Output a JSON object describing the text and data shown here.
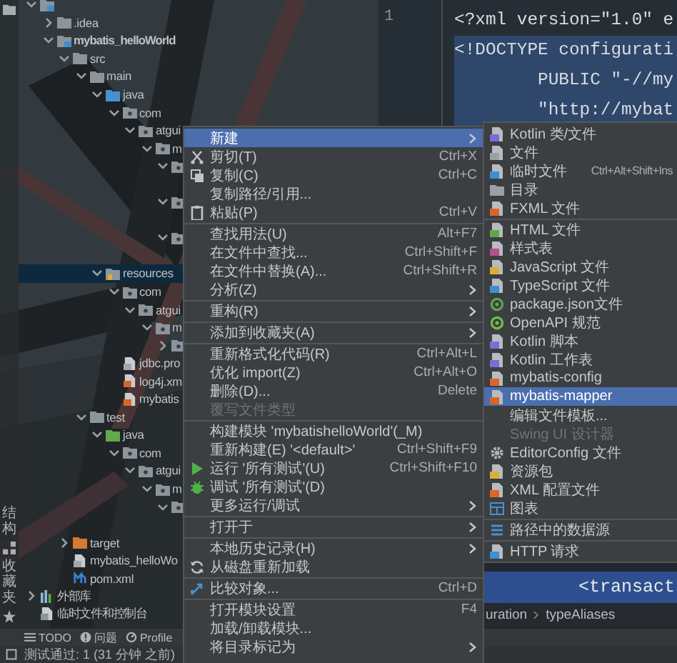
{
  "side_tabs": [
    {
      "label": "结构"
    },
    {
      "label": "收藏夹"
    }
  ],
  "project_tree": [
    {
      "kind": "module",
      "expanded": true,
      "selected": false,
      "children": [
        {
          "label": ".idea",
          "kind": "folder",
          "expanded": false,
          "selected": false
        },
        {
          "label": "mybatis_helloWorld",
          "kind": "module",
          "expanded": true,
          "selected": false,
          "children": [
            {
              "label": "src",
              "kind": "folder",
              "expanded": true,
              "selected": false,
              "children": [
                {
                  "label": "main",
                  "kind": "folder",
                  "expanded": true,
                  "selected": false,
                  "children": [
                    {
                      "label": "java",
                      "kind": "source-folder",
                      "expanded": true,
                      "selected": false,
                      "children": [
                        {
                          "label": "com",
                          "kind": "package",
                          "expanded": true,
                          "selected": false,
                          "children": [
                            {
                              "label": "atgui",
                              "kind": "package",
                              "expanded": true,
                              "selected": false,
                              "children": [
                                {
                                  "label": "m",
                                  "kind": "package",
                                  "expanded": true,
                                  "selected": false,
                                  "children": [
                                    {
                                      "kind": "package",
                                      "expanded": true,
                                      "selected": false
                                    },
                                    {
                                      "kind": "package",
                                      "expanded": true,
                                      "selected": false
                                    },
                                    {
                                      "kind": "package",
                                      "expanded": true,
                                      "selected": false
                                    }
                                  ]
                                }
                              ]
                            }
                          ]
                        }
                      ]
                    },
                    {
                      "label": "resources",
                      "kind": "resource-folder",
                      "expanded": true,
                      "selected": true,
                      "children": [
                        {
                          "label": "com",
                          "kind": "package",
                          "expanded": true,
                          "selected": false,
                          "children": [
                            {
                              "label": "atgui",
                              "kind": "package",
                              "expanded": true,
                              "selected": false,
                              "children": [
                                {
                                  "label": "m",
                                  "kind": "package",
                                  "expanded": true,
                                  "selected": false,
                                  "children": [
                                    {
                                      "kind": "package",
                                      "expanded": false,
                                      "selected": false
                                    }
                                  ]
                                }
                              ]
                            }
                          ]
                        },
                        {
                          "label": "jdbc.pro",
                          "kind": "properties-file",
                          "selected": false
                        },
                        {
                          "label": "log4j.xm",
                          "kind": "xml-file",
                          "selected": false
                        },
                        {
                          "label": "mybatis",
                          "kind": "xml-file",
                          "selected": false
                        }
                      ]
                    }
                  ]
                },
                {
                  "label": "test",
                  "kind": "folder",
                  "expanded": true,
                  "selected": false,
                  "children": [
                    {
                      "label": "java",
                      "kind": "test-folder",
                      "expanded": true,
                      "selected": false,
                      "children": [
                        {
                          "label": "com",
                          "kind": "package",
                          "expanded": true,
                          "selected": false,
                          "children": [
                            {
                              "label": "atgui",
                              "kind": "package",
                              "expanded": true,
                              "selected": false,
                              "children": [
                                {
                                  "label": "m",
                                  "kind": "package",
                                  "expanded": true,
                                  "selected": false,
                                  "children": [
                                    {
                                      "kind": "package",
                                      "expanded": true,
                                      "selected": false
                                    }
                                  ]
                                }
                              ]
                            }
                          ]
                        }
                      ]
                    }
                  ]
                }
              ]
            },
            {
              "label": "target",
              "kind": "excluded-folder",
              "expanded": false,
              "selected": false
            },
            {
              "label": "mybatis_helloWo",
              "kind": "iml-file",
              "selected": false
            },
            {
              "label": "pom.xml",
              "kind": "maven-file",
              "selected": false
            }
          ]
        }
      ]
    },
    {
      "label": "外部库",
      "kind": "library",
      "expanded": false,
      "selected": false
    },
    {
      "label": "临时文件和控制台",
      "kind": "scratches",
      "selected": false
    }
  ],
  "editor": {
    "line_numbers": [
      "1"
    ],
    "code_lines": [
      "<?xml version=\"1.0\" e",
      "<!DOCTYPE configurati",
      "        PUBLIC \"-//my",
      "        \"http://mybat"
    ],
    "lower_code_line": "<transact",
    "breadcrumb": [
      "uration",
      "typeAliases"
    ]
  },
  "context_menu": {
    "groups": [
      [
        {
          "label": "新建",
          "kind": "plain",
          "has_submenu": true,
          "selected": true,
          "disabled": false
        },
        {
          "label": "剪切(T)",
          "shortcut": "Ctrl+X",
          "kind": "cut",
          "has_submenu": false,
          "selected": false,
          "disabled": false
        },
        {
          "label": "复制(C)",
          "shortcut": "Ctrl+C",
          "kind": "copy",
          "has_submenu": false,
          "selected": false,
          "disabled": false
        },
        {
          "label": "复制路径/引用...",
          "kind": "plain",
          "has_submenu": false,
          "selected": false,
          "disabled": false
        },
        {
          "label": "粘贴(P)",
          "shortcut": "Ctrl+V",
          "kind": "paste",
          "has_submenu": false,
          "selected": false,
          "disabled": false
        }
      ],
      [
        {
          "label": "查找用法(U)",
          "shortcut": "Alt+F7",
          "kind": "plain",
          "has_submenu": false,
          "selected": false,
          "disabled": false
        },
        {
          "label": "在文件中查找...",
          "shortcut": "Ctrl+Shift+F",
          "kind": "plain",
          "has_submenu": false,
          "selected": false,
          "disabled": false
        },
        {
          "label": "在文件中替换(A)...",
          "shortcut": "Ctrl+Shift+R",
          "kind": "plain",
          "has_submenu": false,
          "selected": false,
          "disabled": false
        },
        {
          "label": "分析(Z)",
          "kind": "plain",
          "has_submenu": true,
          "selected": false,
          "disabled": false
        }
      ],
      [
        {
          "label": "重构(R)",
          "kind": "plain",
          "has_submenu": true,
          "selected": false,
          "disabled": false
        }
      ],
      [
        {
          "label": "添加到收藏夹(A)",
          "kind": "plain",
          "has_submenu": true,
          "selected": false,
          "disabled": false
        }
      ],
      [
        {
          "label": "重新格式化代码(R)",
          "shortcut": "Ctrl+Alt+L",
          "kind": "plain",
          "has_submenu": false,
          "selected": false,
          "disabled": false
        },
        {
          "label": "优化 import(Z)",
          "shortcut": "Ctrl+Alt+O",
          "kind": "plain",
          "has_submenu": false,
          "selected": false,
          "disabled": false
        },
        {
          "label": "删除(D)...",
          "shortcut": "Delete",
          "kind": "plain",
          "has_submenu": false,
          "selected": false,
          "disabled": false
        },
        {
          "label": "覆写文件类型",
          "kind": "plain",
          "has_submenu": false,
          "selected": false,
          "disabled": true
        }
      ],
      [
        {
          "label": "构建模块 'mybatishelloWorld'(_M)",
          "kind": "plain",
          "has_submenu": false,
          "selected": false,
          "disabled": false
        },
        {
          "label": "重新构建(E) '<default>'",
          "shortcut": "Ctrl+Shift+F9",
          "kind": "plain",
          "has_submenu": false,
          "selected": false,
          "disabled": false
        },
        {
          "label": "运行 '所有测试'(U)",
          "shortcut": "Ctrl+Shift+F10",
          "kind": "run",
          "has_submenu": false,
          "selected": false,
          "disabled": false
        },
        {
          "label": "调试 '所有测试'(D)",
          "kind": "debug",
          "has_submenu": false,
          "selected": false,
          "disabled": false
        },
        {
          "label": "更多运行/调试",
          "kind": "plain",
          "has_submenu": true,
          "selected": false,
          "disabled": false
        }
      ],
      [
        {
          "label": "打开于",
          "kind": "plain",
          "has_submenu": true,
          "selected": false,
          "disabled": false
        }
      ],
      [
        {
          "label": "本地历史记录(H)",
          "kind": "plain",
          "has_submenu": true,
          "selected": false,
          "disabled": false
        },
        {
          "label": "从磁盘重新加载",
          "kind": "reload",
          "has_submenu": false,
          "selected": false,
          "disabled": false
        }
      ],
      [
        {
          "label": "比较对象...",
          "shortcut": "Ctrl+D",
          "kind": "compare",
          "has_submenu": false,
          "selected": false,
          "disabled": false
        }
      ],
      [
        {
          "label": "打开模块设置",
          "shortcut": "F4",
          "kind": "plain",
          "has_submenu": false,
          "selected": false,
          "disabled": false
        },
        {
          "label": "加载/卸载模块...",
          "kind": "plain",
          "has_submenu": false,
          "selected": false,
          "disabled": false
        },
        {
          "label": "将目录标记为",
          "kind": "plain",
          "has_submenu": true,
          "selected": false,
          "disabled": false
        }
      ]
    ]
  },
  "new_submenu": {
    "groups": [
      [
        {
          "label": "Kotlin 类/文件",
          "kind": "kotlin-file",
          "selected": false,
          "disabled": false
        },
        {
          "label": "文件",
          "kind": "file",
          "selected": false,
          "disabled": false
        },
        {
          "label": "临时文件",
          "shortcut": "Ctrl+Alt+Shift+Ins",
          "kind": "scratch-file",
          "selected": false,
          "disabled": false
        },
        {
          "label": "目录",
          "kind": "directory",
          "selected": false,
          "disabled": false
        },
        {
          "label": "FXML 文件",
          "kind": "fxml-file",
          "selected": false,
          "disabled": false
        }
      ],
      [
        {
          "label": "HTML 文件",
          "kind": "html-file",
          "selected": false,
          "disabled": false
        },
        {
          "label": "样式表",
          "kind": "stylesheet",
          "selected": false,
          "disabled": false
        },
        {
          "label": "JavaScript 文件",
          "kind": "javascript-file",
          "selected": false,
          "disabled": false
        },
        {
          "label": "TypeScript 文件",
          "kind": "typescript-file",
          "selected": false,
          "disabled": false
        },
        {
          "label": "package.json文件",
          "kind": "package-json",
          "selected": false,
          "disabled": false
        },
        {
          "label": "OpenAPI 规范",
          "kind": "openapi",
          "selected": false,
          "disabled": false
        },
        {
          "label": "Kotlin 脚本",
          "kind": "kotlin-script",
          "selected": false,
          "disabled": false
        },
        {
          "label": "Kotlin 工作表",
          "kind": "kotlin-worksheet",
          "selected": false,
          "disabled": false
        },
        {
          "label": "mybatis-config",
          "kind": "mybatis-config",
          "selected": false,
          "disabled": false
        },
        {
          "label": "mybatis-mapper",
          "kind": "mybatis-mapper",
          "selected": true,
          "disabled": false
        },
        {
          "label": "编辑文件模板...",
          "kind": "plain",
          "selected": false,
          "disabled": false
        },
        {
          "label": "Swing UI 设计器",
          "kind": "plain",
          "selected": false,
          "disabled": true
        },
        {
          "label": "EditorConfig 文件",
          "kind": "editorconfig",
          "selected": false,
          "disabled": false
        },
        {
          "label": "资源包",
          "kind": "resource-bundle",
          "selected": false,
          "disabled": false
        },
        {
          "label": "XML 配置文件",
          "kind": "xml-config",
          "selected": false,
          "disabled": false
        },
        {
          "label": "图表",
          "kind": "diagram",
          "selected": false,
          "disabled": false
        }
      ],
      [
        {
          "label": "路径中的数据源",
          "kind": "datasource",
          "selected": false,
          "disabled": false
        }
      ],
      [
        {
          "label": "HTTP 请求",
          "kind": "http-request",
          "selected": false,
          "disabled": false
        }
      ]
    ]
  },
  "tool_tabs": [
    {
      "label": "TODO",
      "kind": "todo"
    },
    {
      "label": "问题",
      "kind": "problems"
    },
    {
      "label": "Profile",
      "kind": "profiler"
    }
  ],
  "status_bar": {
    "text": "测试通过: 1 (31 分钟 之前)"
  }
}
